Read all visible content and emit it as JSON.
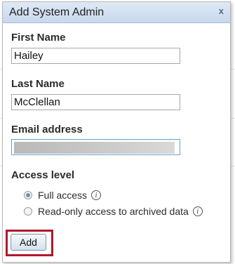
{
  "dialog": {
    "title": "Add System Admin",
    "close_glyph": "x"
  },
  "form": {
    "first_name_label": "First Name",
    "first_name_value": "Hailey",
    "last_name_label": "Last Name",
    "last_name_value": "McClellan",
    "email_label": "Email address",
    "email_value": "",
    "access_level_label": "Access level",
    "access_options": [
      {
        "label": "Full access",
        "selected": true,
        "info_icon": "info-circle-icon"
      },
      {
        "label": "Read-only access to archived data",
        "selected": false,
        "info_icon": "info-circle-icon"
      }
    ],
    "info_glyph": "i",
    "add_label": "Add"
  },
  "colors": {
    "titlebar": "#c8d8ee",
    "highlight": "#b0182e",
    "radio_selected": "#6c8fb8"
  }
}
